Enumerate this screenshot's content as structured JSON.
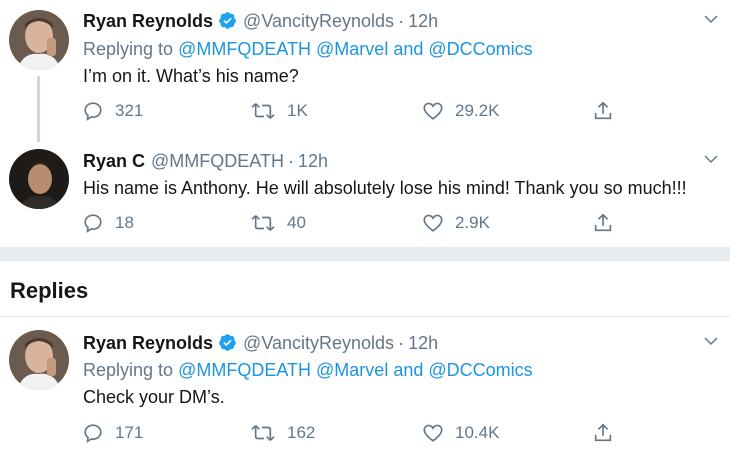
{
  "tweets": [
    {
      "name": "Ryan Reynolds",
      "verified": true,
      "handle": "@VancityReynolds",
      "dot": "·",
      "time": "12h",
      "replying_prefix": "Replying to",
      "mentions": [
        "@MMFQDEATH",
        "@Marvel",
        "@DCComics"
      ],
      "and_word": "and",
      "text": "I’m on it. What’s his name?",
      "replies": "321",
      "retweets": "1K",
      "likes": "29.2K"
    },
    {
      "name": "Ryan C",
      "verified": false,
      "handle": "@MMFQDEATH",
      "dot": "·",
      "time": "12h",
      "text": "His name is Anthony. He will absolutely lose his mind! Thank you so much!!!",
      "replies": "18",
      "retweets": "40",
      "likes": "2.9K"
    },
    {
      "name": "Ryan Reynolds",
      "verified": true,
      "handle": "@VancityReynolds",
      "dot": "·",
      "time": "12h",
      "replying_prefix": "Replying to",
      "mentions": [
        "@MMFQDEATH",
        "@Marvel",
        "@DCComics"
      ],
      "and_word": "and",
      "text": "Check your DM’s.",
      "replies": "171",
      "retweets": "162",
      "likes": "10.4K"
    }
  ],
  "replies_heading": "Replies",
  "colors": {
    "link": "#1b95e0",
    "muted": "#657786",
    "verified": "#1da1f2",
    "divider": "#e6ecf0"
  },
  "icons": {
    "reply": "reply-icon",
    "retweet": "retweet-icon",
    "like": "heart-icon",
    "share": "share-icon",
    "more": "chevron-down-icon",
    "verified": "verified-badge-icon"
  }
}
